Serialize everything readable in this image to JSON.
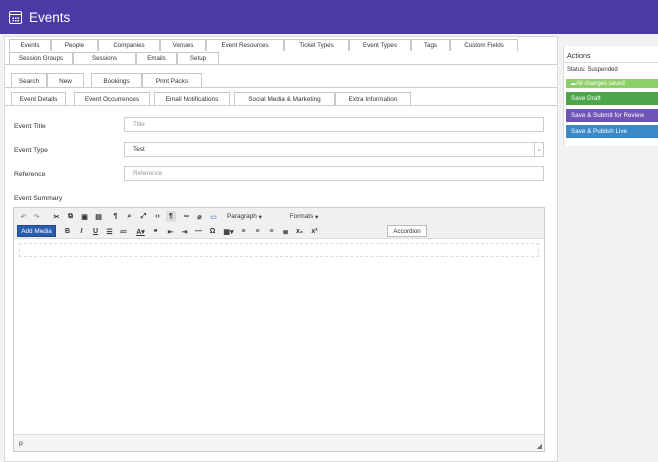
{
  "app": {
    "title": "Events"
  },
  "nav": {
    "row1": [
      "Events",
      "People",
      "Companies",
      "Venues",
      "Event Resources",
      "Ticket Types",
      "Event Types",
      "Tags",
      "Custom Fields"
    ],
    "row2": [
      "Session Groups",
      "Sessions",
      "Emails",
      "Setup"
    ]
  },
  "subtabs": [
    "Search",
    "New",
    "Bookings",
    "Print Packs"
  ],
  "formtabs": [
    "Event Details",
    "Event Occurrences",
    "Email Notifications",
    "Social Media & Marketing",
    "Extra Information"
  ],
  "form": {
    "title_label": "Event Title",
    "title_placeholder": "Title",
    "type_label": "Event Type",
    "type_value": "Test",
    "ref_label": "Reference",
    "ref_placeholder": "Reference",
    "summary_label": "Event Summary"
  },
  "editor": {
    "add_media": "Add Media",
    "format_dropdown": "Paragraph",
    "formats_dropdown": "Formats",
    "accordion": "Accordion",
    "status_path": "p"
  },
  "sidebar": {
    "title": "Actions",
    "status": "Status: Suspended",
    "saved": "All changes saved",
    "save_draft": "Save Draft",
    "submit_review": "Save & Submit for Review",
    "publish_live": "Save & Publish Live"
  },
  "colors": {
    "header": "#4b3aa6",
    "saved": "#8ed068",
    "draft": "#4ca54a",
    "review": "#7055b8",
    "publish": "#3a89c9",
    "add_media": "#2a5db0"
  }
}
